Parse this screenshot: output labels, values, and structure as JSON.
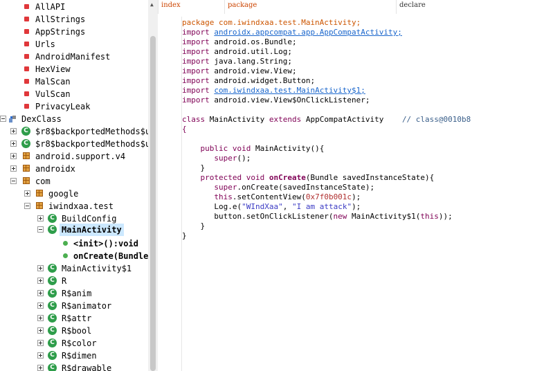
{
  "tree": {
    "top_items": [
      "AllAPI",
      "AllStrings",
      "AppStrings",
      "Urls",
      "AndroidManifest",
      "HexView",
      "MalScan",
      "VulScan",
      "PrivacyLeak"
    ],
    "dexclass": "DexClass",
    "backported1": "$r8$backportedMethods$u",
    "backported2": "$r8$backportedMethods$u",
    "android_support": "android.support.v4",
    "androidx": "androidx",
    "com": "com",
    "google": "google",
    "iwindxaa": "iwindxaa.test",
    "buildconfig": "BuildConfig",
    "mainactivity": "MainActivity",
    "init": "<init>():void",
    "oncreate": "onCreate(Bundle",
    "classes": [
      "MainActivity$1",
      "R",
      "R$anim",
      "R$animator",
      "R$attr",
      "R$bool",
      "R$color",
      "R$dimen",
      "R$drawable"
    ]
  },
  "header": {
    "index": "index",
    "package": "package",
    "declare": "declare"
  },
  "code": {
    "package_kw": "package",
    "package_name": "com.iwindxaa.test.MainActivity;",
    "import_kw": "import",
    "imports": [
      "androidx.appcompat.app.AppCompatActivity;",
      "android.os.Bundle;",
      "android.util.Log;",
      "java.lang.String;",
      "android.view.View;",
      "android.widget.Button;",
      "com.iwindxaa.test.MainActivity$1;",
      "android.view.View$OnClickListener;"
    ],
    "class_kw": "class",
    "class_name": "MainActivity",
    "extends_kw": "extends",
    "super_class": "AppCompatActivity",
    "class_comment": "// class@0010b8",
    "open_brace": "{",
    "close_brace": "}",
    "public_void": "public void",
    "ctor": "MainActivity(){",
    "super_call": "super",
    "super_rest": "();",
    "inner_close": "}",
    "protected_void": "protected void",
    "oncreate_name": "onCreate",
    "oncreate_params": "(Bundle savedInstanceState){",
    "super_oncreate_rest": ".onCreate(savedInstanceState);",
    "this_kw": "this",
    "setcontent": ".setContentView(",
    "setcontent_val": "0x7f0b001c",
    "setcontent_end": ");",
    "log_call": "Log.e(",
    "log_arg1": "\"WIndXaa\"",
    "log_comma": ", ",
    "log_arg2": "\"I am attack\"",
    "log_end": ");",
    "button_call": "button.setOnClickListener(",
    "new_kw": "new",
    "button_mid": " MainActivity$1(",
    "button_end": "));"
  }
}
